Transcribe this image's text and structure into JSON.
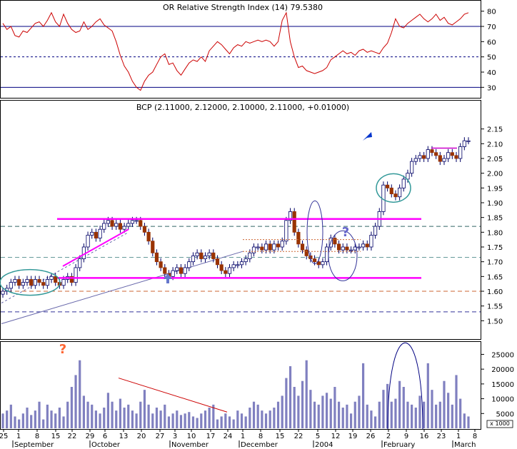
{
  "rsi_panel": {
    "title": "OR Relative Strength Index (14) 79.5380",
    "ylim": [
      25,
      85
    ],
    "ticks": [
      30,
      40,
      50,
      60,
      70,
      80
    ],
    "reference_levels": [
      70,
      50,
      30
    ]
  },
  "price_panel": {
    "title": "BCP (2.11000, 2.12000, 2.10000, 2.11000, +0.01000)",
    "ylim": [
      1.45,
      2.2
    ],
    "ticks": [
      1.5,
      1.55,
      1.6,
      1.65,
      1.7,
      1.75,
      1.8,
      1.85,
      1.9,
      1.95,
      2.0,
      2.05,
      2.1,
      2.15
    ],
    "tick_labels": [
      "1.50",
      "1.55",
      "1.60",
      "1.65",
      "1.70",
      "1.75",
      "1.80",
      "1.85",
      "1.90",
      "1.95",
      "2.00",
      "2.05",
      "2.10",
      "2.15"
    ],
    "support_line": 1.645,
    "resistance_line": 1.845,
    "annotation_marks": [
      "?",
      "?"
    ]
  },
  "volume_panel": {
    "ylim": [
      0,
      28000
    ],
    "ticks": [
      5000,
      10000,
      15000,
      20000,
      25000
    ],
    "tick_labels": [
      "5000",
      "10000",
      "15000",
      "20000",
      "25000"
    ],
    "unit_label": "x 1000",
    "annotation_mark": "?"
  },
  "x_axis": {
    "day_labels": [
      "25",
      "1",
      "8",
      "15",
      "22",
      "29",
      "6",
      "13",
      "20",
      "27",
      "3",
      "10",
      "17",
      "24",
      "1",
      "8",
      "15",
      "22",
      "5",
      "12",
      "19",
      "26",
      "2",
      "9",
      "16",
      "23",
      "1",
      "8"
    ],
    "month_labels": [
      "September",
      "October",
      "November",
      "December",
      "2004",
      "February",
      "March"
    ]
  },
  "colors": {
    "up_candle": "#ffffff",
    "down_candle": "#993300",
    "candle_outline": "#000066",
    "rsi_line": "#cc0000",
    "reference_line": "#000080",
    "support_resistance": "#ff00ff",
    "volume_bar": "#8080c0",
    "ellipse_green": "#339999",
    "ellipse_blue": "#333399",
    "question_orange": "#ff6633",
    "question_blue": "#6666cc",
    "arrow_blue": "#0033cc",
    "trend_red": "#cc0000"
  },
  "chart_data": [
    {
      "type": "line",
      "title": "OR Relative Strength Index (14) 79.5380",
      "series": [
        {
          "name": "Relative Strength Index (14)",
          "values": [
            72,
            68,
            70,
            64,
            63,
            67,
            66,
            69,
            72,
            73,
            70,
            74,
            79,
            73,
            70,
            78,
            72,
            68,
            66,
            67,
            73,
            68,
            70,
            73,
            75,
            71,
            69,
            67,
            60,
            51,
            44,
            40,
            34,
            30,
            28,
            34,
            38,
            40,
            45,
            50,
            52,
            45,
            46,
            41,
            38,
            42,
            46,
            48,
            47,
            50,
            47,
            54,
            57,
            60,
            58,
            55,
            52,
            56,
            58,
            57,
            60,
            59,
            60,
            61,
            60,
            61,
            60,
            57,
            60,
            74,
            79,
            60,
            50,
            43,
            44,
            41,
            40,
            39,
            40,
            41,
            43,
            48,
            50,
            52,
            54,
            52,
            53,
            51,
            54,
            55,
            53,
            54,
            53,
            52,
            56,
            59,
            66,
            75,
            70,
            69,
            72,
            74,
            76,
            78,
            75,
            73,
            75,
            78,
            74,
            76,
            72,
            71,
            73,
            75,
            78,
            79
          ]
        }
      ],
      "ylim": [
        25,
        85
      ]
    },
    {
      "type": "candlestick",
      "title": "BCP (2.11000, 2.12000, 2.10000, 2.11000, +0.01000)",
      "ylim": [
        1.45,
        2.2
      ],
      "series": [
        {
          "name": "BCP",
          "close": [
            1.6,
            1.61,
            1.63,
            1.64,
            1.62,
            1.63,
            1.64,
            1.62,
            1.64,
            1.63,
            1.62,
            1.64,
            1.65,
            1.63,
            1.62,
            1.64,
            1.65,
            1.63,
            1.68,
            1.71,
            1.75,
            1.79,
            1.8,
            1.78,
            1.81,
            1.83,
            1.84,
            1.82,
            1.83,
            1.81,
            1.82,
            1.83,
            1.84,
            1.84,
            1.82,
            1.8,
            1.77,
            1.73,
            1.7,
            1.68,
            1.66,
            1.65,
            1.67,
            1.68,
            1.66,
            1.68,
            1.7,
            1.72,
            1.73,
            1.71,
            1.72,
            1.73,
            1.71,
            1.69,
            1.67,
            1.66,
            1.68,
            1.69,
            1.69,
            1.7,
            1.71,
            1.73,
            1.75,
            1.75,
            1.74,
            1.76,
            1.74,
            1.76,
            1.75,
            1.77,
            1.84,
            1.87,
            1.8,
            1.76,
            1.74,
            1.72,
            1.71,
            1.7,
            1.69,
            1.7,
            1.75,
            1.78,
            1.76,
            1.74,
            1.75,
            1.74,
            1.74,
            1.75,
            1.75,
            1.76,
            1.75,
            1.79,
            1.82,
            1.87,
            1.96,
            1.95,
            1.93,
            1.92,
            1.95,
            1.98,
            2.0,
            2.04,
            2.05,
            2.06,
            2.05,
            2.08,
            2.07,
            2.06,
            2.04,
            2.05,
            2.07,
            2.06,
            2.05,
            2.09,
            2.11,
            2.11
          ]
        }
      ],
      "support": 1.645,
      "resistance": 1.845
    },
    {
      "type": "bar",
      "title": "",
      "ylim": [
        0,
        28000
      ],
      "series": [
        {
          "name": "Volume",
          "values": [
            5000,
            6000,
            8000,
            4000,
            3000,
            5000,
            7000,
            4500,
            6000,
            9000,
            3000,
            8000,
            6000,
            5000,
            7000,
            4000,
            9000,
            14000,
            18000,
            23000,
            11000,
            9000,
            8000,
            6000,
            5000,
            7000,
            12000,
            9000,
            6000,
            10000,
            7000,
            8000,
            6000,
            5000,
            9000,
            13000,
            8000,
            5000,
            7000,
            6000,
            8000,
            4000,
            5000,
            6000,
            4500,
            5000,
            5500,
            4000,
            3500,
            5000,
            6000,
            7000,
            8000,
            3000,
            4000,
            5000,
            4000,
            3000,
            6000,
            5000,
            4000,
            7000,
            9000,
            8000,
            6000,
            5000,
            6000,
            7000,
            9000,
            11000,
            17000,
            21000,
            14000,
            11000,
            16000,
            23000,
            13000,
            9000,
            8000,
            11000,
            12000,
            10000,
            14000,
            9000,
            7000,
            8000,
            5000,
            9000,
            11000,
            22000,
            8000,
            6000,
            4000,
            9000,
            13000,
            15000,
            9000,
            10000,
            16000,
            14000,
            9000,
            8000,
            7000,
            11000,
            9000,
            22000,
            13000,
            8000,
            9000,
            16000,
            12000,
            8000,
            18000,
            10000,
            5000,
            4000
          ]
        }
      ]
    }
  ]
}
